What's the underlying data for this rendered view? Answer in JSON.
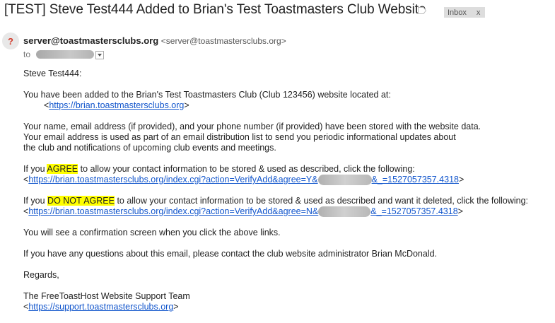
{
  "email": {
    "subject": "[TEST] Steve Test444 Added to Brian's Test Toastmasters Club Website",
    "inbox_label": "Inbox",
    "inbox_remove": "x",
    "avatar_glyph": "?",
    "sender_name": "server@toastmastersclubs.org",
    "sender_address": "<server@toastmastersclubs.org>",
    "to_label": "to",
    "greeting": "Steve Test444:",
    "added_text": "You have been added to the Brian's Test Toastmasters Club (Club 123456) website located at:",
    "site_url": "https://brian.toastmastersclubs.org",
    "stored_line1": "Your name, email address (if provided), and your phone number (if provided) have been stored with the website data.",
    "stored_line2": "Your email address is used as part of an email distribution list to send you periodic informational updates about",
    "stored_line3": "the club and notifications of upcoming club events and meetings.",
    "agree_prefix": "If you ",
    "agree_word": "AGREE",
    "agree_suffix": " to allow your contact information to be stored & used as described, click the following:",
    "agree_url_start": "https://brian.toastmastersclubs.org/index.cgi?action=VerifyAdd&agree=Y&",
    "agree_url_end": "&_=1527057357.4318",
    "disagree_prefix": "If you ",
    "disagree_word": "DO NOT AGREE",
    "disagree_suffix": " to allow your contact information to be stored & used as described and want it deleted, click the following:",
    "disagree_url_start": "https://brian.toastmastersclubs.org/index.cgi?action=VerifyAdd&agree=N&",
    "disagree_url_end": "&_=1527057357.4318",
    "confirmation": "You will see a confirmation screen when you click the above links.",
    "questions": "If you have any questions about this email, please contact the club website administrator Brian McDonald.",
    "regards": "Regards,",
    "team": "The FreeToastHost Website Support Team",
    "support_url": "https://support.toastmastersclubs.org",
    "lt": "<",
    "gt": ">"
  }
}
